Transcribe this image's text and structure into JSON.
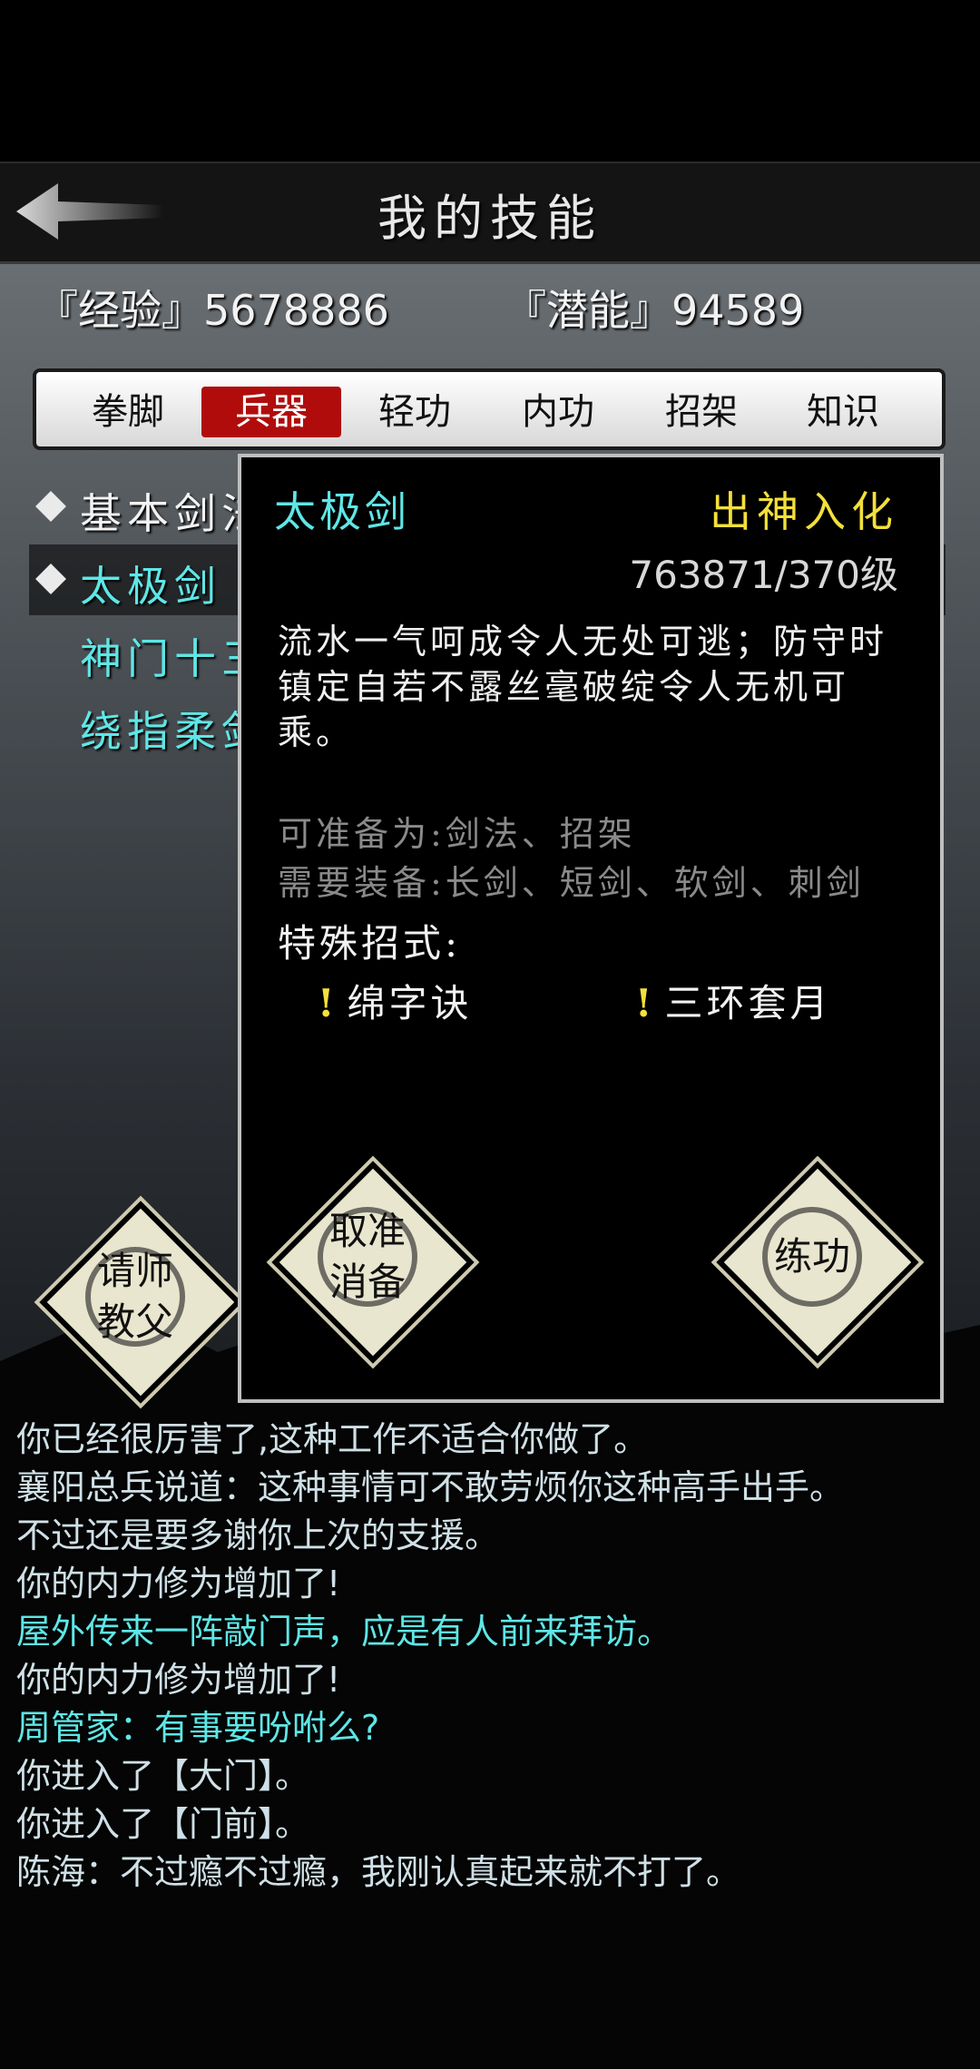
{
  "header": {
    "title": "我的技能"
  },
  "stats": {
    "experience_label": "『经验』5678886",
    "potential_label": "『潜能』94589"
  },
  "tabs": [
    "拳脚",
    "兵器",
    "轻功",
    "内功",
    "招架",
    "知识"
  ],
  "active_tab": "兵器",
  "skill_list": [
    {
      "name": "基本剑法",
      "color": "#f2f2f2",
      "selected": false
    },
    {
      "name": "太极剑",
      "color": "#5fe6e6",
      "selected": true
    },
    {
      "name": "神门十三剑",
      "color": "#5fe6e6",
      "selected": false
    },
    {
      "name": "绕指柔剑",
      "color": "#5fe6e6",
      "selected": false
    }
  ],
  "left_button": {
    "label_line1": "请师",
    "label_line2": "教父"
  },
  "popup": {
    "name": "太极剑",
    "rank": "出神入化",
    "level": "763871/370级",
    "description": "流水一气呵成令人无处可逃；防守时镇定自若不露丝毫破绽令人无机可乘。",
    "prepare": "可准备为:剑法、招架",
    "equip": "需要装备:长剑、短剑、软剑、刺剑",
    "special_title": "特殊招式:",
    "moves": [
      "绵字诀",
      "三环套月"
    ],
    "move_marker": "!",
    "cancel_button": {
      "line1": "取准",
      "line2": "消备"
    },
    "practice_button": "练功"
  },
  "log": [
    {
      "text": "你已经很厉害了,这种工作不适合你做了。",
      "color": "#cfe0e6"
    },
    {
      "text": "襄阳总兵说道：这种事情可不敢劳烦你这种高手出手。",
      "color": "#cfe0e6"
    },
    {
      "text": "不过还是要多谢你上次的支援。",
      "color": "#cfe0e6"
    },
    {
      "text": "你的内力修为增加了!",
      "color": "#cfe0e6"
    },
    {
      "text": "屋外传来一阵敲门声，应是有人前来拜访。",
      "color": "#5fe6e6"
    },
    {
      "text": "你的内力修为增加了!",
      "color": "#cfe0e6"
    },
    {
      "text": "周管家：有事要吩咐么?",
      "color": "#5fe6e6"
    },
    {
      "text": "你进入了【大门】。",
      "color": "#cfe0e6"
    },
    {
      "text": "你进入了【门前】。",
      "color": "#cfe0e6"
    },
    {
      "text": "陈海：不过瘾不过瘾，我刚认真起来就不打了。",
      "color": "#cfe0e6"
    }
  ],
  "colors": {
    "accent_red": "#b00c0c",
    "cyan": "#5fe6e6",
    "gold": "#f3e03a"
  }
}
